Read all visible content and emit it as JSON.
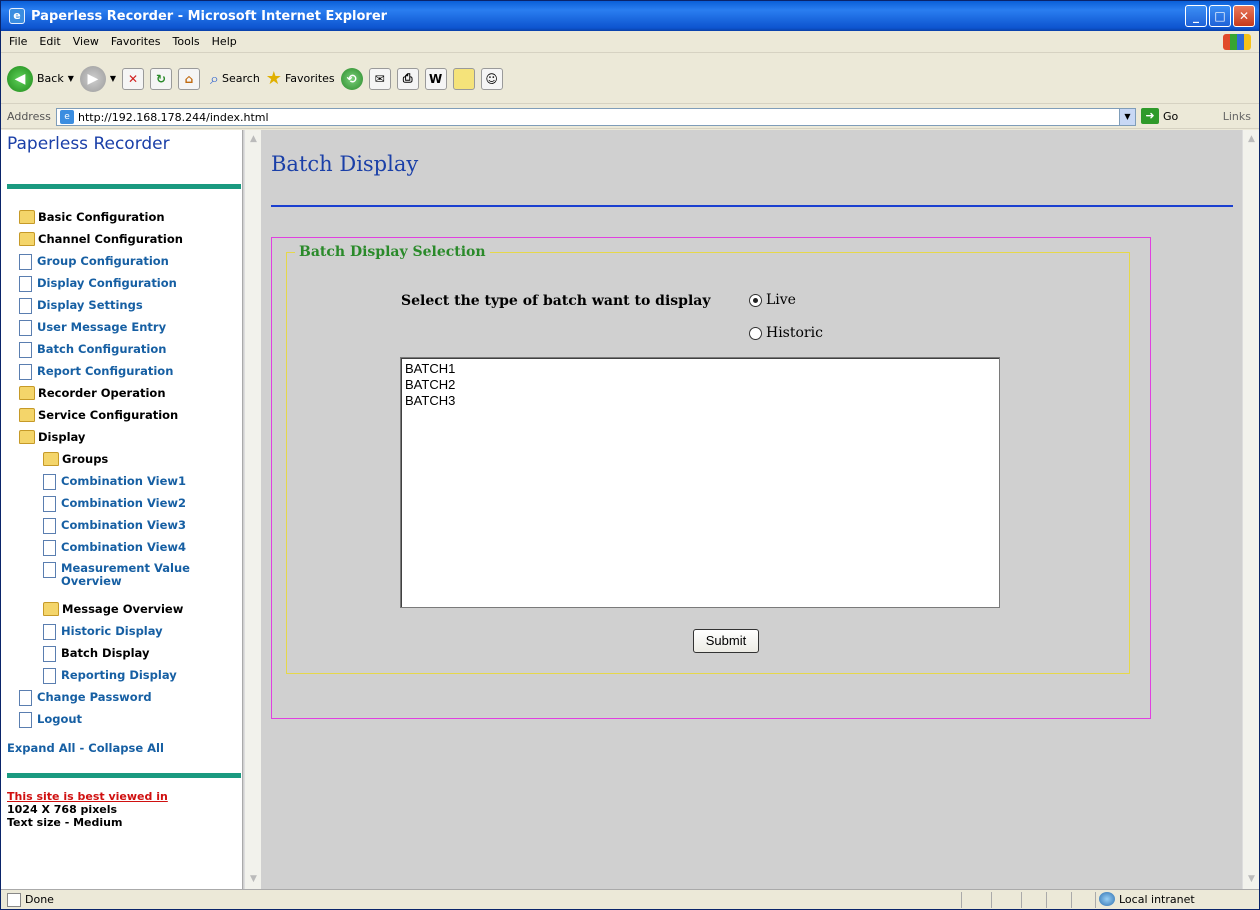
{
  "window": {
    "title": "Paperless Recorder - Microsoft Internet Explorer"
  },
  "menubar": [
    "File",
    "Edit",
    "View",
    "Favorites",
    "Tools",
    "Help"
  ],
  "toolbar": {
    "back": "Back",
    "search": "Search",
    "favorites": "Favorites"
  },
  "address": {
    "label": "Address",
    "url": "http://192.168.178.244/index.html",
    "go": "Go",
    "links": "Links"
  },
  "sidebar": {
    "title": "Paperless Recorder",
    "items": [
      {
        "label": "Basic Configuration",
        "icon": "folder-icon",
        "style": "plain"
      },
      {
        "label": "Channel Configuration",
        "icon": "folder-icon",
        "style": "plain"
      },
      {
        "label": "Group Configuration",
        "icon": "document-icon",
        "style": "link"
      },
      {
        "label": "Display Configuration",
        "icon": "document-icon",
        "style": "link"
      },
      {
        "label": "Display Settings",
        "icon": "document-icon",
        "style": "link"
      },
      {
        "label": "User Message Entry",
        "icon": "document-icon",
        "style": "link"
      },
      {
        "label": "Batch Configuration",
        "icon": "document-icon",
        "style": "link"
      },
      {
        "label": "Report Configuration",
        "icon": "document-icon",
        "style": "link"
      },
      {
        "label": "Recorder Operation",
        "icon": "folder-icon",
        "style": "plain"
      },
      {
        "label": "Service Configuration",
        "icon": "folder-icon",
        "style": "plain"
      },
      {
        "label": "Display",
        "icon": "open-folder-icon",
        "style": "plain"
      },
      {
        "label": "Groups",
        "icon": "folder-icon",
        "style": "plain"
      },
      {
        "label": "Combination View1",
        "icon": "document-icon",
        "style": "link"
      },
      {
        "label": "Combination View2",
        "icon": "document-icon",
        "style": "link"
      },
      {
        "label": "Combination View3",
        "icon": "document-icon",
        "style": "link"
      },
      {
        "label": "Combination View4",
        "icon": "document-icon",
        "style": "link"
      },
      {
        "label": "Measurement Value Overview",
        "icon": "document-icon",
        "style": "link"
      },
      {
        "label": "Message Overview",
        "icon": "folder-icon",
        "style": "plain"
      },
      {
        "label": "Historic Display",
        "icon": "document-icon",
        "style": "link"
      },
      {
        "label": "Batch Display",
        "icon": "document-icon",
        "style": "plain"
      },
      {
        "label": "Reporting Display",
        "icon": "document-icon",
        "style": "link"
      },
      {
        "label": "Change Password",
        "icon": "document-icon",
        "style": "link"
      },
      {
        "label": "Logout",
        "icon": "document-icon",
        "style": "link"
      }
    ],
    "expand_collapse": "Expand All - Collapse All",
    "best_viewed": "This site is best viewed in",
    "resolution": "1024 X 768 pixels",
    "text_size": "Text size - Medium"
  },
  "main": {
    "heading": "Batch Display",
    "section_legend": "Batch Display Selection",
    "question": "Select the type of batch want to display",
    "radio_live": "Live",
    "radio_historic": "Historic",
    "selected": "Live",
    "batches": [
      "BATCH1",
      "BATCH2",
      "BATCH3"
    ],
    "submit": "Submit"
  },
  "status": {
    "left": "Done",
    "zone": "Local intranet"
  },
  "colors": {
    "heading": "#1a3fa8",
    "legend": "#2a8a2a",
    "outer_border": "#e040e0",
    "inner_border": "#e6d84a",
    "link": "#165fa3"
  }
}
